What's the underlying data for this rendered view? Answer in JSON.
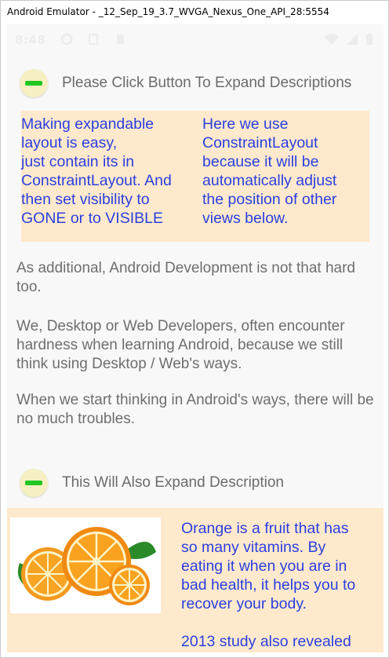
{
  "window": {
    "title": "Android Emulator - _12_Sep_19_3.7_WVGA_Nexus_One_API_28:5554"
  },
  "statusbar": {
    "time": "8:48"
  },
  "section1": {
    "title": "Please Click Button To Expand Descriptions",
    "left_text": "Making expandable\nlayout is easy,\njust contain its in\nConstraintLayout. And\nthen set visibility to\nGONE or to VISIBLE",
    "right_text": "Here we use\nConstraintLayout\nbecause it will be\nautomatically adjust\nthe position of other\nviews below."
  },
  "paragraphs": [
    "As additional, Android Development is not that hard too.",
    "We, Desktop or Web Developers, often encounter hardness when learning Android, because we still think using Desktop / Web's ways.",
    "When we start thinking in Android's ways, there will be no much troubles."
  ],
  "section2": {
    "title": "This Will Also Expand Description",
    "text": "Orange is a fruit that has\nso many vitamins. By\neating it when you are in\nbad health, it helps you to\nrecover your body.\n\n2013 study also revealed"
  },
  "icons": {
    "expand_toggle": "minus-icon",
    "orange": "orange-fruit-image"
  },
  "colors": {
    "accent_blue": "#2b3fe0",
    "panel_bg": "#ffe9cc",
    "toggle_green": "#22c622",
    "toggle_bg": "#f6efc2"
  }
}
